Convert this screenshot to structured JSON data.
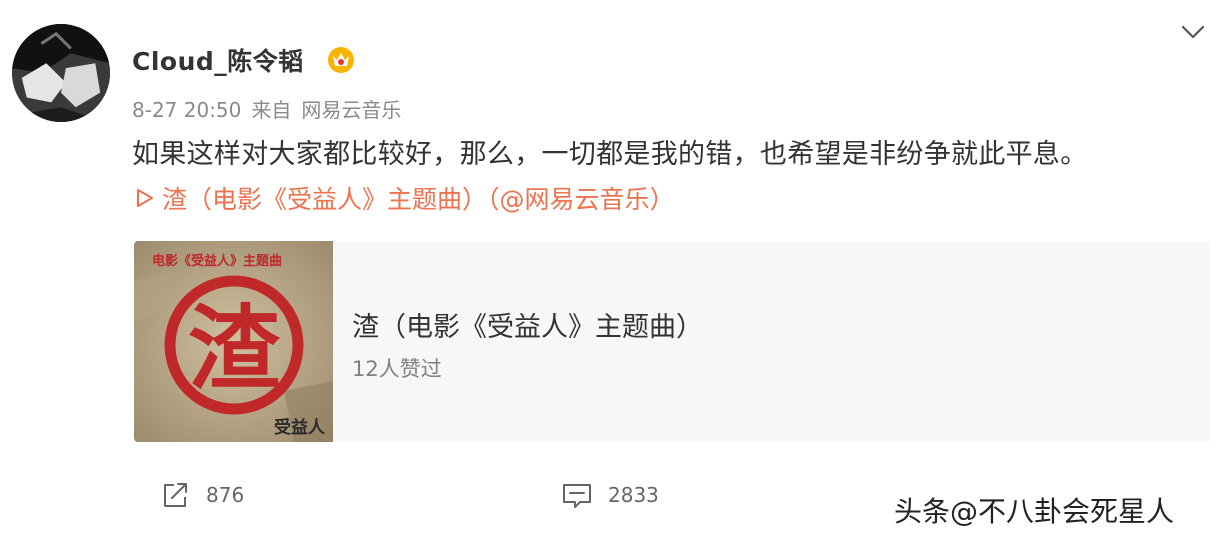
{
  "post": {
    "username": "Cloud_陈令韬",
    "date": "8-27 20:50",
    "source_prefix": "来自",
    "source_app": "网易云音乐",
    "text": "如果这样对大家都比较好，那么，一切都是我的错，也希望是非纷争就此平息。",
    "music_link": "渣（电影《受益人》主题曲）（@网易云音乐）"
  },
  "card": {
    "title": "渣（电影《受益人》主题曲）",
    "subtitle": "12人赞过",
    "cover": {
      "top_text": "电影《受益人》主题曲",
      "big_char": "渣",
      "bottom_text": "受益人"
    }
  },
  "actions": {
    "repost_count": "876",
    "comment_count": "2833"
  },
  "watermark": "头条@不八卦会死星人",
  "colors": {
    "link": "#eb7350",
    "card_bg": "#f7f7f7",
    "meta": "#8a8a8a",
    "stamp_red": "#c0282a"
  },
  "icons": [
    "chevron-down-icon",
    "vip-crown-icon",
    "play-icon",
    "repost-icon",
    "comment-icon"
  ]
}
